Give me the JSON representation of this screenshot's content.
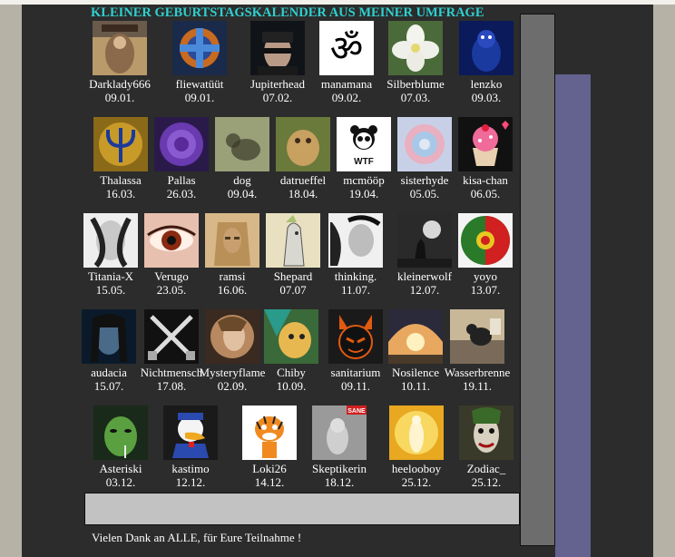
{
  "title": "KLEINER GEBURTSTAGSKALENDER AUS MEINER UMFRAGE",
  "footer": "Vielen Dank an ALLE, für Eure Teilnahme !",
  "entries": [
    {
      "name": "Darklady666",
      "date": "09.01."
    },
    {
      "name": "fliewatüüt",
      "date": "09.01."
    },
    {
      "name": "Jupiterhead",
      "date": "07.02."
    },
    {
      "name": "manamana",
      "date": "09.02."
    },
    {
      "name": "Silberblume",
      "date": "07.03."
    },
    {
      "name": "lenzko",
      "date": "09.03."
    },
    {
      "name": "Thalassa",
      "date": "16.03."
    },
    {
      "name": "Pallas",
      "date": "26.03."
    },
    {
      "name": "dog",
      "date": "09.04."
    },
    {
      "name": "datrueffel",
      "date": "18.04."
    },
    {
      "name": "mcmööp",
      "date": "19.04."
    },
    {
      "name": "sisterhyde",
      "date": "05.05."
    },
    {
      "name": "kisa-chan",
      "date": "06.05."
    },
    {
      "name": "Titania-X",
      "date": "15.05."
    },
    {
      "name": "Verugo",
      "date": "23.05."
    },
    {
      "name": "ramsi",
      "date": "16.06."
    },
    {
      "name": "Shepard",
      "date": "07.07"
    },
    {
      "name": "thinking.",
      "date": "11.07."
    },
    {
      "name": "kleinerwolf",
      "date": "12.07."
    },
    {
      "name": "yoyo",
      "date": "13.07."
    },
    {
      "name": "audacia",
      "date": "15.07."
    },
    {
      "name": "Nichtmensch",
      "date": "17.08."
    },
    {
      "name": "Mysteryflame",
      "date": "02.09."
    },
    {
      "name": "Chiby",
      "date": "10.09."
    },
    {
      "name": "sanitarium",
      "date": "09.11."
    },
    {
      "name": "Nosilence",
      "date": "10.11."
    },
    {
      "name": "Wasserbrenne",
      "date": "19.11."
    },
    {
      "name": "Asteriski",
      "date": "03.12."
    },
    {
      "name": "kastimo",
      "date": "12.12."
    },
    {
      "name": "Loki26",
      "date": "14.12."
    },
    {
      "name": "Skeptikerin",
      "date": "18.12."
    },
    {
      "name": "heelooboy",
      "date": "25.12."
    },
    {
      "name": "Zodiac_",
      "date": "25.12."
    }
  ],
  "avatar_labels": {
    "wwf": "WTF",
    "sane": "SANE"
  },
  "colors": {
    "title": "#2fd0d0",
    "panel": "#2c2c2c",
    "text": "#ffffff"
  }
}
